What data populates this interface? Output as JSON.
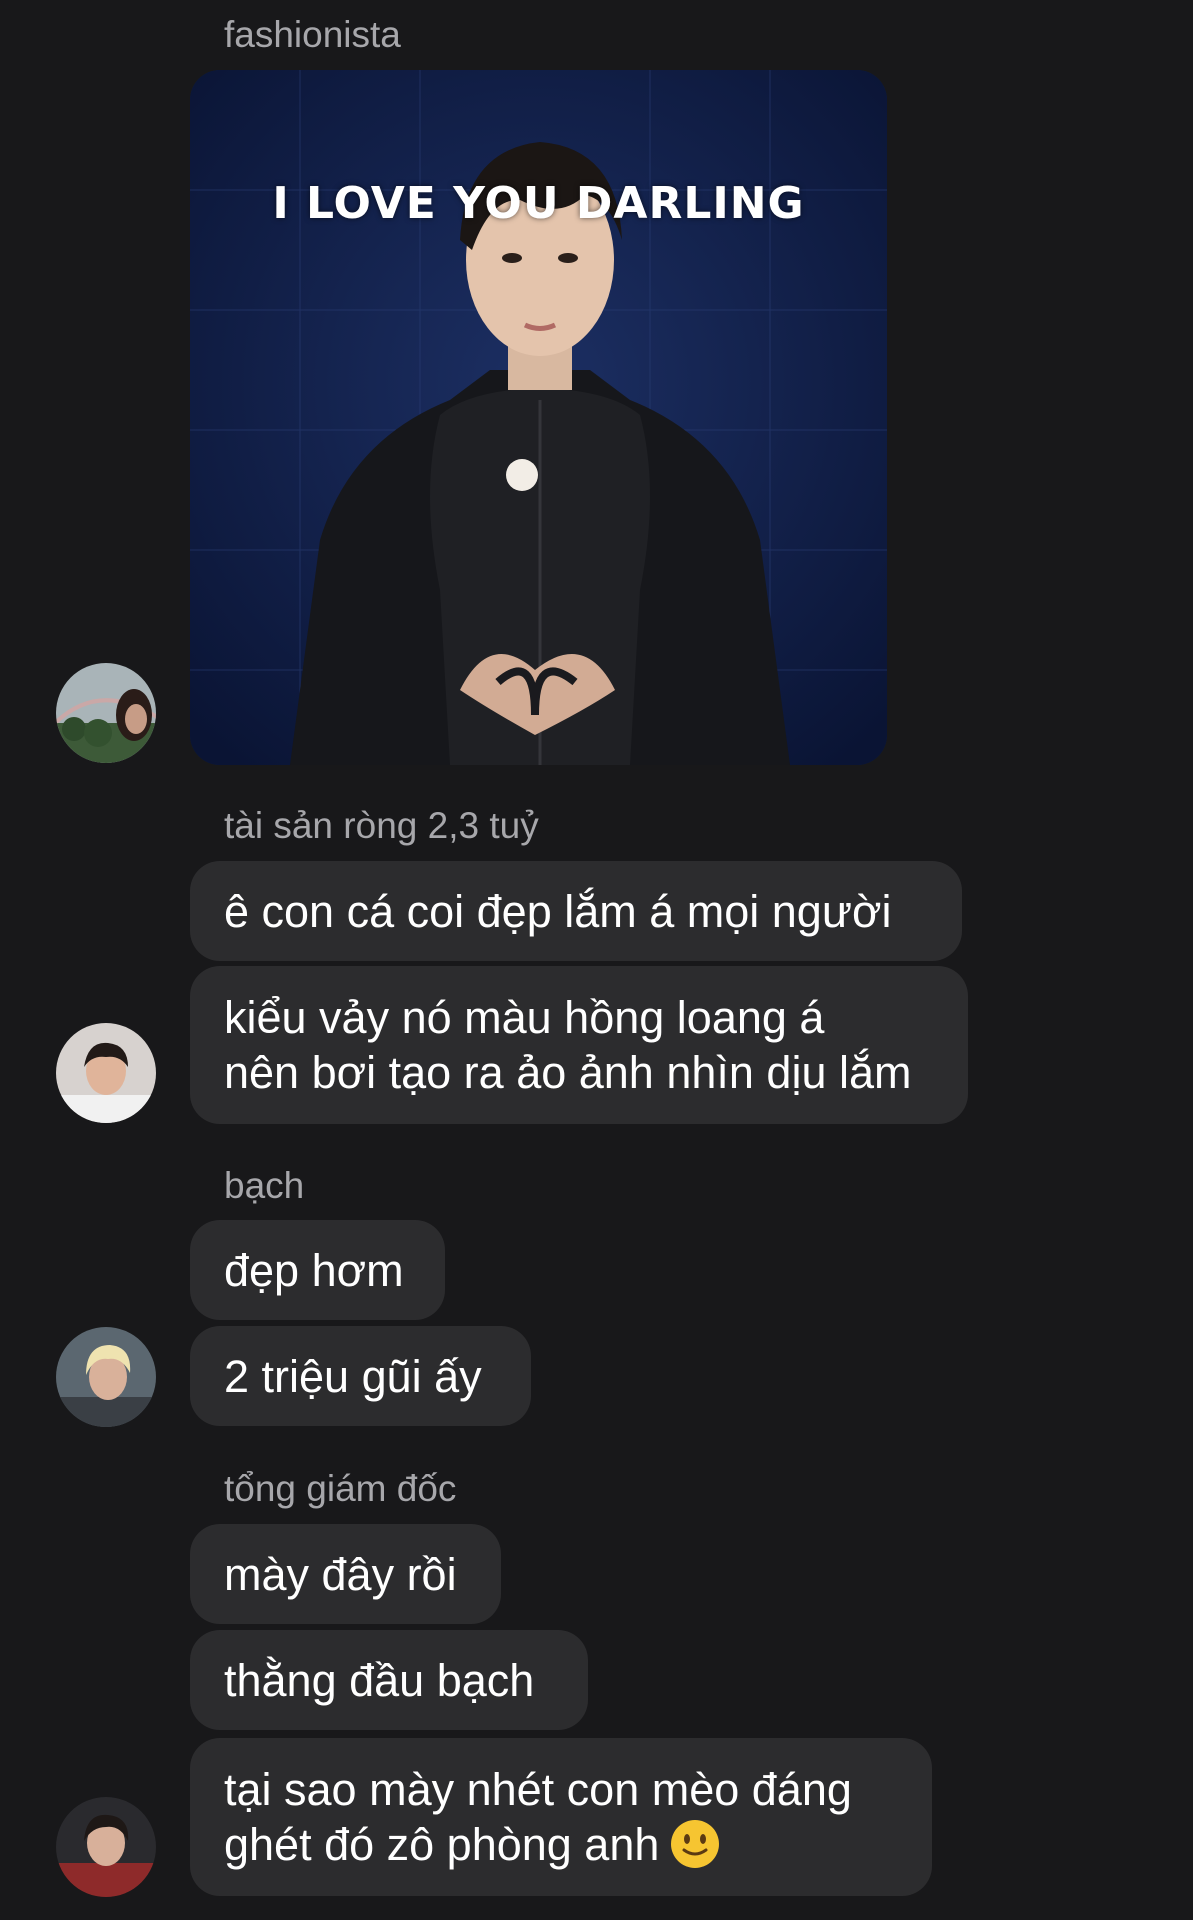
{
  "colors": {
    "background": "#18181a",
    "bubble": "#2c2c2e",
    "sender_name": "#a7a7ab",
    "text": "#ffffff"
  },
  "messages": [
    {
      "sender": "fashionista",
      "type": "image",
      "image_caption": "I LOVE YOU DARLING",
      "avatar": "avatar-rainbow-landscape"
    },
    {
      "sender": "tài sản ròng 2,3 tuỷ",
      "type": "text",
      "bubbles": [
        "ê con cá coi đẹp lắm á mọi người",
        "kiểu vảy nó màu hồng loang á",
        "nên bơi tạo ra ảo ảnh nhìn dịu lắm"
      ],
      "avatar": "avatar-young-man"
    },
    {
      "sender": "bạch",
      "type": "text",
      "bubbles": [
        "đẹp hơm",
        "2 triệu gũi ấy"
      ],
      "avatar": "avatar-blond-man"
    },
    {
      "sender": "tổng giám đốc",
      "type": "text",
      "bubbles": [
        "mày đây rồi",
        "thằng đầu bạch",
        "tại sao mày nhét con mèo đáng",
        "ghét đó zô phòng anh"
      ],
      "emoji": "slightly-smiling-face-icon",
      "avatar": "avatar-man-red-jacket"
    }
  ]
}
